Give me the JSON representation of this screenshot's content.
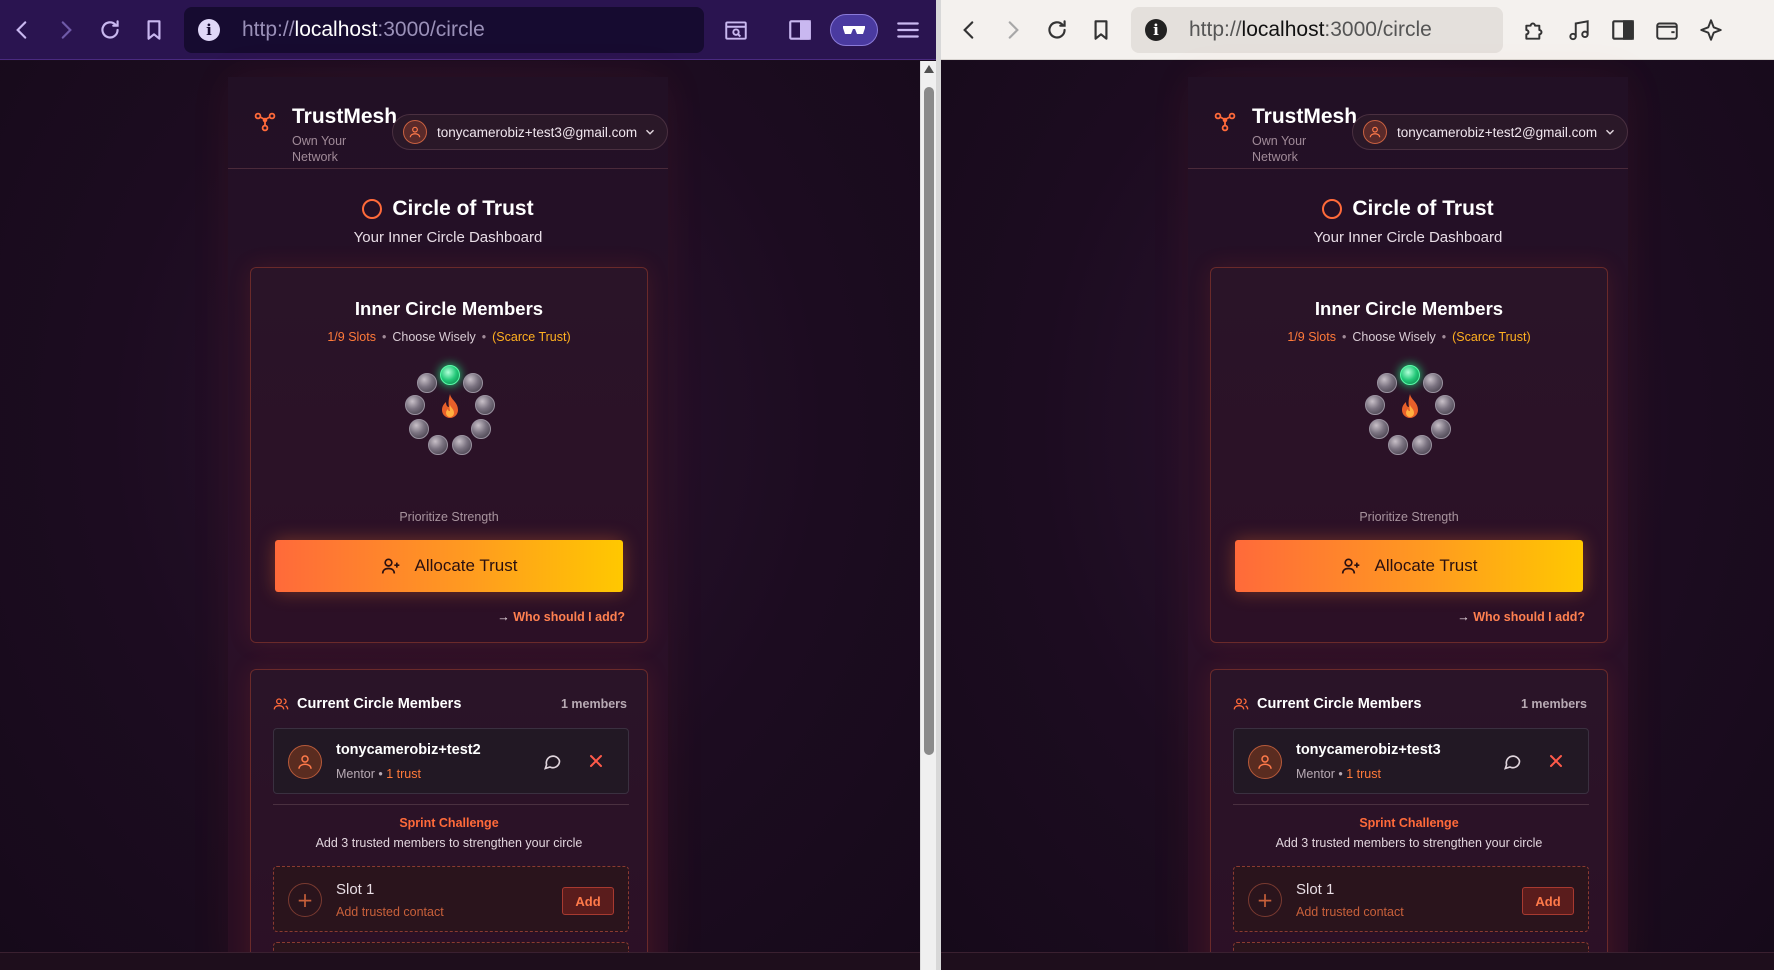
{
  "windows": [
    {
      "url": {
        "proto": "http://",
        "host": "localhost",
        "path": ":3000/circle"
      },
      "app": {
        "brand": "TrustMesh",
        "tagline": "Own Your Network",
        "account_email": "tonycamerobiz+test3@gmail.com"
      },
      "member": {
        "name": "tonycamerobiz+test2",
        "role": "Mentor •",
        "trust": "1 trust"
      }
    },
    {
      "url": {
        "proto": "http://",
        "host": "localhost",
        "path": ":3000/circle"
      },
      "app": {
        "brand": "TrustMesh",
        "tagline": "Own Your Network",
        "account_email": "tonycamerobiz+test2@gmail.com"
      },
      "member": {
        "name": "tonycamerobiz+test3",
        "role": "Mentor •",
        "trust": "1 trust"
      }
    }
  ],
  "page": {
    "title": "Circle of Trust",
    "subtitle": "Your Inner Circle Dashboard",
    "inner_circle": {
      "title": "Inner Circle Members",
      "slots": "1/9 Slots",
      "choose": "Choose Wisely",
      "scarce": "(Scarce Trust)",
      "filled_slots": 1,
      "total_slots": 9,
      "prioritize": "Prioritize Strength",
      "allocate_label": "Allocate Trust",
      "who_arrow": "→",
      "who_link": "Who should I add?"
    },
    "current": {
      "title": "Current Circle Members",
      "count": "1 members",
      "sprint_title": "Sprint Challenge",
      "sprint_desc": "Add 3 trusted members to strengthen your circle",
      "slot_name": "Slot 1",
      "slot_hint": "Add trusted contact",
      "add_label": "Add",
      "plus": "+"
    }
  },
  "colors": {
    "accent": "#ff6a3a",
    "gold": "#ffc800",
    "active_orb": "#22c878"
  },
  "icons": [
    "back-icon",
    "forward-icon",
    "reload-icon",
    "bookmark-icon",
    "info-icon",
    "search-page-icon",
    "sidebar-icon",
    "glasses-icon",
    "menu-icon",
    "extensions-icon",
    "music-icon",
    "wallet-icon",
    "sparkle-icon",
    "network-logo-icon",
    "user-icon",
    "chevron-down-icon",
    "user-plus-icon",
    "users-icon",
    "chat-icon",
    "close-icon",
    "flame-icon"
  ]
}
